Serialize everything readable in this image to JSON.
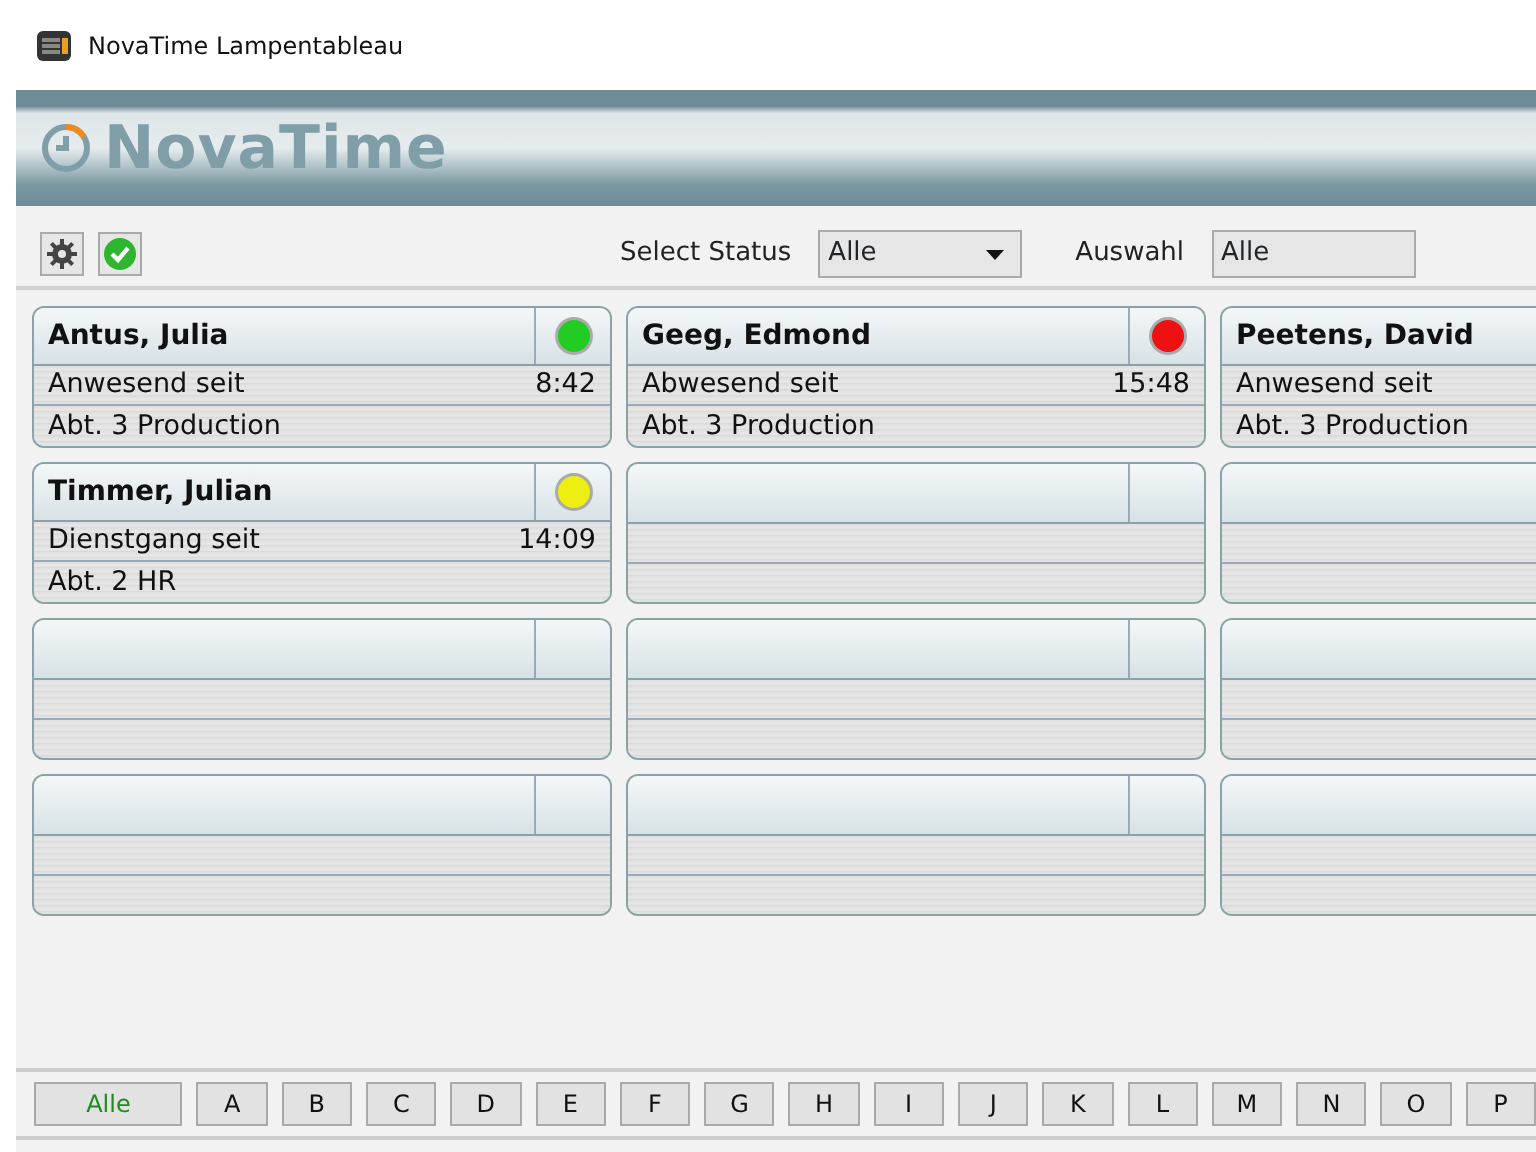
{
  "window": {
    "title": "NovaTime Lampentableau"
  },
  "banner": {
    "logo": "NovaTime"
  },
  "toolbar": {
    "status_label": "Select Status",
    "status_value": "Alle",
    "selection_label": "Auswahl",
    "selection_value": "Alle"
  },
  "cards": [
    {
      "kind": "person",
      "name": "Antus, Julia",
      "color": "#22cc22",
      "status": "Anwesend seit",
      "time": "8:42",
      "department": "Abt. 3 Production"
    },
    {
      "kind": "person",
      "name": "Geeg, Edmond",
      "color": "#ee1111",
      "status": "Abwesend seit",
      "time": "15:48",
      "department": "Abt. 3 Production"
    },
    {
      "kind": "person",
      "name": "Peetens, David",
      "status": "Anwesend seit",
      "department": "Abt. 3 Production"
    },
    {
      "kind": "person",
      "name": "Timmer, Julian",
      "color": "#eeee11",
      "status": "Dienstgang seit",
      "time": "14:09",
      "department": "Abt. 2 HR"
    },
    {
      "kind": "empty"
    },
    {
      "kind": "empty"
    },
    {
      "kind": "empty"
    },
    {
      "kind": "empty"
    },
    {
      "kind": "empty"
    },
    {
      "kind": "empty"
    },
    {
      "kind": "empty"
    },
    {
      "kind": "empty"
    }
  ],
  "letters": [
    {
      "label": "Alle",
      "selected": true
    },
    {
      "label": "A",
      "selected": false
    },
    {
      "label": "B",
      "selected": false
    },
    {
      "label": "C",
      "selected": false
    },
    {
      "label": "D",
      "selected": false
    },
    {
      "label": "E",
      "selected": false
    },
    {
      "label": "F",
      "selected": false
    },
    {
      "label": "G",
      "selected": false
    },
    {
      "label": "H",
      "selected": false
    },
    {
      "label": "I",
      "selected": false
    },
    {
      "label": "J",
      "selected": false
    },
    {
      "label": "K",
      "selected": false
    },
    {
      "label": "L",
      "selected": false
    },
    {
      "label": "M",
      "selected": false
    },
    {
      "label": "N",
      "selected": false
    },
    {
      "label": "O",
      "selected": false
    },
    {
      "label": "P",
      "selected": false
    }
  ]
}
